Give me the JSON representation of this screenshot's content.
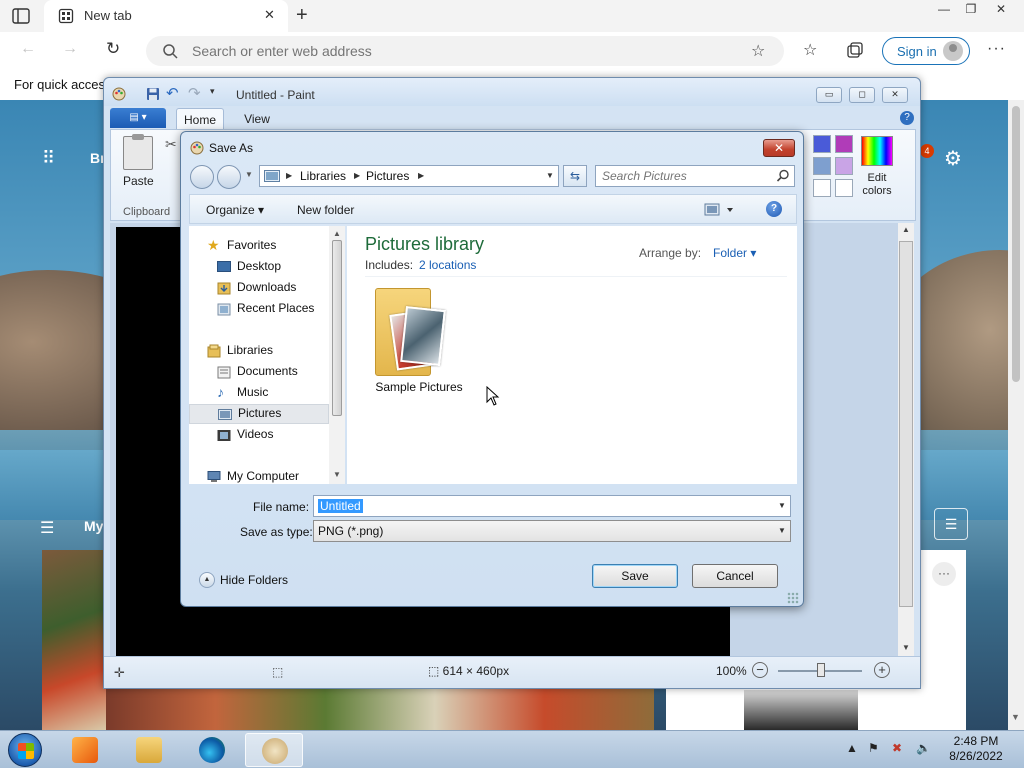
{
  "browser": {
    "tab": {
      "title": "New tab",
      "close": "✕"
    },
    "new_tab": "+",
    "window_controls": {
      "minimize": "—",
      "maximize": "❐",
      "close": "✕"
    },
    "address_placeholder": "Search or enter web address",
    "sign_in": "Sign in",
    "more": "···",
    "favorites_bar_text": "For quick access, place your favorites here on the favorites bar."
  },
  "ntp": {
    "brand": "Br",
    "notification_count": "4",
    "feed_label": "My",
    "more": "···"
  },
  "paint": {
    "title": "Untitled - Paint",
    "file_menu": "▤ ▾",
    "tabs": {
      "home": "Home",
      "view": "View"
    },
    "help": "?",
    "paste_label": "Paste",
    "clipboard_label": "Clipboard",
    "edit_colors_label": "Edit colors",
    "swatches": [
      "#4a5bd8",
      "#b03cb8",
      "#7e9fcf",
      "#c9a4e6",
      "#ffffff",
      "#ffffff"
    ],
    "canvas_size": "614 × 460px",
    "zoom": "100%",
    "zoom_out": "−",
    "zoom_in": "+",
    "window_controls": {
      "minimize": "▭",
      "maximize": "◻",
      "close": "✕"
    }
  },
  "dialog": {
    "title": "Save As",
    "close": "✕",
    "address_crumbs": [
      "Libraries",
      "Pictures"
    ],
    "search_placeholder": "Search Pictures",
    "commands": {
      "organize": "Organize ▾",
      "new_folder": "New folder",
      "help": "?"
    },
    "nav": {
      "favorites": "Favorites",
      "desktop": "Desktop",
      "downloads": "Downloads",
      "recent_places": "Recent Places",
      "libraries": "Libraries",
      "documents": "Documents",
      "music": "Music",
      "pictures": "Pictures",
      "videos": "Videos",
      "my_computer": "My Computer"
    },
    "library_title": "Pictures library",
    "includes_label": "Includes:",
    "includes_link": "2 locations",
    "arrange_label": "Arrange by:",
    "arrange_value": "Folder ▾",
    "folder_item": "Sample Pictures",
    "file_name_label": "File name:",
    "file_name_value": "Untitled",
    "save_type_label": "Save as type:",
    "save_type_value": "PNG (*.png)",
    "hide_folders": "Hide Folders",
    "save": "Save",
    "cancel": "Cancel"
  },
  "taskbar": {
    "time": "2:48 PM",
    "date": "8/26/2022"
  }
}
